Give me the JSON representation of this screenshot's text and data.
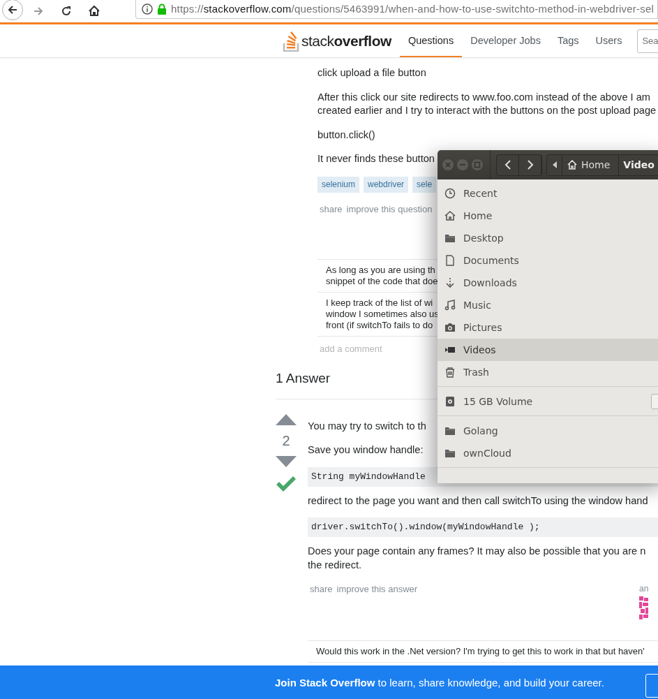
{
  "browser": {
    "url": {
      "scheme": "https://",
      "host": "stackoverflow.com",
      "path": "/questions/5463991/when-and-how-to-use-switchto-method-in-webdriver-sel"
    }
  },
  "site_header": {
    "logo": "stack**overflow**",
    "nav": [
      {
        "label": "Questions",
        "selected": true
      },
      {
        "label": "Developer Jobs",
        "selected": false
      },
      {
        "label": "Tags",
        "selected": false
      },
      {
        "label": "Users",
        "selected": false
      }
    ],
    "search": {
      "placeholder": "Sea"
    }
  },
  "question": {
    "blocks": [
      {
        "kind": "text",
        "lines": [
          "click upload a file button"
        ]
      },
      {
        "kind": "text",
        "lines": [
          "After this click our site redirects to www.foo.com instead of the above I am",
          "created earlier and I try to interact with the buttons on the post upload page"
        ]
      },
      {
        "kind": "text",
        "lines": [
          "button.click()"
        ]
      },
      {
        "kind": "text",
        "lines": [
          "It never finds these button"
        ]
      }
    ],
    "tags": [
      "selenium",
      "webdriver",
      "sele"
    ],
    "post_menu": [
      "share",
      "improve this question"
    ],
    "comments": [
      {
        "lines": [
          "As long as you are using th",
          "snippet of the code that doe"
        ]
      },
      {
        "lines": [
          "I keep track of the list of wi",
          "window I sometimes also us",
          "front (if switchTo fails to do"
        ]
      }
    ],
    "add_comment": "add a comment"
  },
  "answers_header": "1 Answer",
  "answer": {
    "score": "2",
    "accepted": true,
    "blocks": [
      {
        "kind": "text",
        "lines": [
          "You may try to switch to th"
        ]
      },
      {
        "kind": "text",
        "lines": [
          "Save you window handle:"
        ]
      },
      {
        "kind": "code",
        "lines": [
          "String myWindowHandle"
        ]
      },
      {
        "kind": "text",
        "lines": [
          "redirect to the page you want and then call switchTo using the window hand"
        ]
      },
      {
        "kind": "code",
        "lines": [
          "driver.switchTo().window(myWindowHandle );"
        ]
      },
      {
        "kind": "text",
        "lines": [
          "Does your page contain any frames? It may also be possible that you are n",
          "the redirect."
        ]
      }
    ],
    "post_menu": [
      "share",
      "improve this answer"
    ],
    "user_card_label": "an",
    "comments": [
      {
        "lines": [
          "Would this work in the .Net version? I'm trying to get this to work in that but haven'"
        ]
      }
    ]
  },
  "file_manager": {
    "path": [
      {
        "label": "Home",
        "kind": "home",
        "selected": false
      },
      {
        "label": "Video",
        "kind": "folder",
        "selected": true
      }
    ],
    "sections": [
      [
        {
          "label": "Recent",
          "kind": "recent",
          "selected": false
        },
        {
          "label": "Home",
          "kind": "home",
          "selected": false
        },
        {
          "label": "Desktop",
          "kind": "folder",
          "selected": false
        },
        {
          "label": "Documents",
          "kind": "document",
          "selected": false
        },
        {
          "label": "Downloads",
          "kind": "download",
          "selected": false
        },
        {
          "label": "Music",
          "kind": "music",
          "selected": false
        },
        {
          "label": "Pictures",
          "kind": "camera",
          "selected": false
        },
        {
          "label": "Videos",
          "kind": "video",
          "selected": true
        },
        {
          "label": "Trash",
          "kind": "trash",
          "selected": false
        }
      ],
      [
        {
          "label": "15 GB Volume",
          "kind": "drive",
          "selected": false
        }
      ],
      [
        {
          "label": "Golang",
          "kind": "folder",
          "selected": false
        },
        {
          "label": "ownCloud",
          "kind": "folder",
          "selected": false
        }
      ]
    ]
  },
  "banner": {
    "text": "**Join Stack Overflow** to learn, share knowledge, and build your career."
  }
}
